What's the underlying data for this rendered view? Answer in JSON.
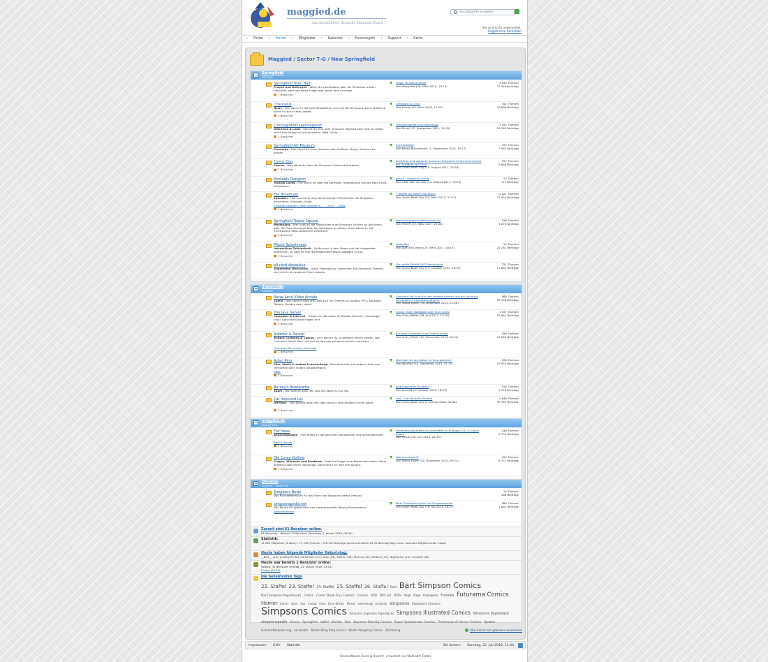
{
  "header": {
    "site_title": "maggied.de",
    "site_sub": "das dienstälteste deutsche Simpsons-Board",
    "search_placeholder": "Suchbegriffe eingeben",
    "login_status": "Sie sind nicht angemeldet.",
    "register": "Registrieren",
    "login": "Anmelden"
  },
  "nav": [
    "Portal",
    "Forum",
    "Mitglieder",
    "Kalender",
    "Forenregeln",
    "Support",
    "Karte"
  ],
  "breadcrumb": "Maggied / Sector 7-G / New Springfield",
  "categories": [
    {
      "title": "Springfield",
      "subtitle": "Off-Topic",
      "boards": [
        {
          "name": "Springfield Town Hall",
          "desc_b": "Fragen und Umfragen",
          "desc": " - Wenn du irgendetwas über die Simpsons wissen möchtest, stell hier deine Frage oder starte eine Umfrage.",
          "visitors": "7 Besucher",
          "lp_title": "Frage: Hinweisschilder",
          "lp_by": "Von stoppoker (26. März 2018, 18:13)",
          "threads": "4 184 Themen",
          "posts": "37 349 Beiträge"
        },
        {
          "name": "Channel 6",
          "desc_b": "News",
          "desc": " - Hier könnt ihr aktuelle Neuigkeiten rund um die Simpsons lesen. Natürlich könnt ihr auch neue posten.",
          "visitors": "2 Besucher",
          "lp_title": "Simpsons & LEGO",
          "lp_by": "Von Freaky (24. März 2018, 12:32)",
          "threads": "352 Themen",
          "posts": "10 860 Beiträge"
        },
        {
          "name": "Comosglobalhypermeganet",
          "desc_b": "Webnews & Links",
          "desc": " - Kennst du eine gute Simpsons Website oder hast du selber eine? Hier kannst du sie vorstellen. Web-Guide",
          "visitors": "1 Besucher",
          "lp_title": "Simpsonspedia hat Geburtstag",
          "lp_by": "Von Blund (23. September 2015, 11:03)",
          "threads": "1 105 Themen",
          "posts": "19 248 Beiträge"
        },
        {
          "name": "Springfield Art Museum",
          "desc_b": "Fanworks",
          "desc": " - Hier könnt ihr eure Fanworks wie Grafiken, Storys, Videos usw. posten.",
          "visitors": "",
          "lp_title": "Eure Grafiken",
          "lp_by": "Von Kenny Brockelstein (1. September 2015, 15:17)",
          "threads": "325 Themen",
          "posts": "7 067 Beiträge"
        },
        {
          "name": "Comic Con",
          "desc_b": "Comics",
          "desc": " - Hier könnt ihr über die Simpsons Comics diskutieren.",
          "visitors": "2 Besucher",
          "lp_title": "Limitierte und signierte deutsche Simpsons / Futurama Comics mit Zertifikat von Ohio",
          "lp_by": "Von Comic Book Guy (15. August 2017, 15:28)",
          "threads": "557 Themen",
          "posts": "6 688 Beiträge"
        },
        {
          "name": "Androids Dungeon",
          "desc_b": "Trading Cards",
          "desc": " - Hier könnt ihr über die normalen Tradingcards und die Bart-Cards diskutieren.",
          "visitors": "",
          "lp_title": "panini - simpsons mania",
          "lp_by": "Von Little Moe Szyslak (17. August 2017, 19:29)",
          "threads": "53 Themen",
          "posts": "717 Beiträge"
        },
        {
          "name": "Fox Broadcast",
          "desc_b": "Episoden",
          "desc": " - Hier kannst du über die einzelnen TV-Episoden der Simpsons diskutieren. Episoden-Guide",
          "subs": "Episodencapsules, Best Episode is..., ...2007, ...2009",
          "visitors": "1 Besucher",
          "lp_title": "7.Staffel Die bösen Nachbarn",
          "lp_by": "Von Comic Book Guy (24. März 2015, 22:37)",
          "threads": "1 227 Themen",
          "posts": "17 420 Beiträge"
        },
        {
          "name": "Springfield Towne Square",
          "desc_b": "Marktplatz",
          "desc": " - Hier habt ihr die Möglichkeit eure Simpsons-Sachen an den Mann oder die Frau zubringen bzw. Suchanfragen zu stellen. Auch könnt ihr auf interessante eBay-Auktionen verweisen.",
          "visitors": "2 Besucher",
          "lp_title": "Verkaufe original Weihnachts Cel",
          "lp_by": "Von PeterR (19. März 2017, 22:00)",
          "threads": "536 Themen",
          "posts": "4 078 Beiträge"
        },
        {
          "name": "Mount Splashmore",
          "desc_b": "Interaktiver Zeitvertreib",
          "desc": " - Sollte euch in dem Board mal die Langeweile bedrücken, so habt ihr hier die Möglichkeit etwas dagegen zu tun.",
          "visitors": "5 Besucher",
          "lp_title": "Sizee 90s",
          "lp_by": "Von Duff_and_more (24. März 2017, 18:43)",
          "threads": "55 Themen",
          "posts": "22 261 Beiträge"
        },
        {
          "name": "alt.nerd.obsessive",
          "desc_b": "Allgemeine Diskussion",
          "desc": " - Diese \"Newsgroup\" behandelt alle Simpsons-Themen, die nicht in die anderen Foren passen.",
          "visitors": "",
          "lp_title": "Der große Staffel DVD Pressthread",
          "lp_by": "Von Comic Book Guy (13. Oktober 2015, 18:25)",
          "threads": "751 Themen",
          "posts": "11 681 Beiträge"
        }
      ]
    },
    {
      "title": "Shelbyville",
      "subtitle": "Off-Topic",
      "boards": [
        {
          "name": "Noise Land Video Arcade",
          "desc_b": "Spiele",
          "desc": " - Hier kommt alles rein, was sich um Themen zu Spielen (PCs, Konsolen, Tablets, Handys usw.) dreht.",
          "visitors": "",
          "lp_title": "Simpsons Hit And Run den Vorteile Ändern und die Leute wo rumlaufen in Charaktere ändern",
          "lp_by": "Von Tobias Egner (18. Dezember 2014, 21:08)",
          "threads": "988 Themen",
          "posts": "16 390 Beiträge"
        },
        {
          "name": "The Java Server",
          "desc_b": "Computer & Internet",
          "desc": " - Fragen zur Windows, IE-Mozilla, Security, Homepage usw.? Dann stellt eure Fragen hier.",
          "visitors": "1 Besucher",
          "lp_title": "Spiron: mein Notebook oder eure Links!",
          "lp_by": "Von Chris_Pfeiler (28. Juni 2017, 15:10)",
          "threads": "1 057 Themen",
          "posts": "22 940 Beiträge"
        },
        {
          "name": "Arbeiter & Parasit",
          "desc_b": "Andere Cartoons & Comics",
          "desc": " - Hier kommt du zu anderen Serien posten, wie Futurama, South Park und halt all das was wir gerne gucken und lesen ...",
          "subs": "Futurama, Bruchbach Serenade",
          "visitors": "1 Besucher",
          "lp_title": "Ein paar Gedanken zum Thema Anime",
          "lp_by": "Von Chris_Pfeiler (11. November 2013, 10:15)",
          "threads": "598 Themen",
          "posts": "17 092 Beiträge"
        },
        {
          "name": "Aztec Kino",
          "desc_b": "Film, Musik & andere Unterhaltung",
          "desc": " - Diskutiert hier mit anderen über das Fernsehen oder andere Alltagsmedien.",
          "subs": "KBBL",
          "visitors": "1 Besucher",
          "lp_title": "Was habt ihr als letztes im Kino gesehen?",
          "lp_by": "Von WickPad (15. Dezember 2014, 12:13)",
          "threads": "726 Themen",
          "posts": "19 924 Beiträge"
        },
        {
          "name": "Barney's Bowlarama",
          "desc_b": "Sport",
          "desc": " - Hier kommt alles rein was mit Sport zu tun hat.",
          "visitors": "",
          "lp_title": "Lieblingsverein (Fußball)",
          "lp_by": "Von Anna09 (4. Oktober 2014, 16:55)",
          "threads": "256 Themen",
          "posts": "7 124 Beiträge"
        },
        {
          "name": "Car Impound Lot",
          "desc_b": "Off-Topic",
          "desc": " - Hier kommt alles rein, was sonst in kein anderes Forum passt.",
          "visitors": "3 Besucher",
          "lp_title": "Wall - Der Neujahrs-Thread",
          "lp_by": "Von Comic Book Guy (1. Januar 2016, 00:06)",
          "threads": "1 646 Themen",
          "posts": "55 393 Beiträge"
        }
      ]
    },
    {
      "title": "maggied.de",
      "subtitle": "Boardintern",
      "boards": [
        {
          "name": "Fox News",
          "desc_b": "Ankündigungen",
          "desc": " - Hier findet ihr die aktuellen Neuigkeiten und Ankündigungen.",
          "subs": "Ranch Relaxo",
          "visitors": "2 Besucher",
          "lp_title": "Vorbereitungsthread für Usertreffen in Erlangen 2014 (Comic Salon)",
          "lp_by": "Von Pascal (30. Juni 2014, 20:35)",
          "threads": "248 Themen",
          "posts": "6 755 Beiträge"
        },
        {
          "name": "Die Corey-Hotline",
          "desc_b": "Fragen, Wünsche und Feedback",
          "desc": " - Habt ihr Fragen zum Board oder einen Fehler entdeckt oder einen Vorschlag? Dann könnt ihr dies hier posten.",
          "visitors": "1 Besucher",
          "lp_title": "Was ist passiert?",
          "lp_by": "Von Tobias Egner (24. Dezember 2015, 09:31)",
          "threads": "453 Themen",
          "posts": "8 771 Beiträge"
        }
      ]
    },
    {
      "title": "Diorama",
      "subtitle": "Projekte - Sector 6G",
      "boards": [
        {
          "name": "Simpsons News",
          "desc_b": "",
          "desc": "Das Mitarbeiterforum für das Team von Simpsons News! (Pascal)",
          "visitors": "",
          "lp_title": "",
          "lp_by": "",
          "threads": "24 Themen",
          "posts": "408 Beiträge"
        },
        {
          "name": "simpsonspedia.net",
          "desc_b": "",
          "desc": "Das Forum für aktive User von simpsonspedia! (Kenny Brockelstein)",
          "subs": "Episodenfehler",
          "visitors": "",
          "lp_title": "Mehr Radioactive Man auf Simpsonspedia",
          "lp_by": "Von Comic Book Guy (19. Juli 2013, 16:37)",
          "threads": "280 Themen",
          "posts": "1 882 Beiträge"
        }
      ]
    }
  ],
  "stats": {
    "online_h": "Zurzeit sind 61 Benutzer online:",
    "online_d": "61 Besucher - Rekord: 12 Benutzer (Samstag, 3. Januar 2016, 09:34)",
    "stat_h": "Statistik:",
    "stat_d": "11 629 Mitglieder (6 aktiv) - 17 338 Themen - 318 207 Beiträge (durchschnittlich 49,39 Beiträge/Tag) Unser neuestes Mitglied heißt: Sawaj.",
    "bday_h": "Heute haben folgende Mitglieder Geburtstag:",
    "bday_d": "__Bart__ (24), guidolyrit (30), hartshirsch (27), Joey (31), Mjérrin (38), Marcus (32), McBane (27), Nightmare (25), uchse00 (29)",
    "was_h": "Heute war bereits 1 Benutzer online:",
    "was_d": "Rekord: 32 Benutzer (Freitag, 22. Januar 2016, 23:51)",
    "was_user": "Freaky (00:59)",
    "tags_h": "Die beliebtesten Tags"
  },
  "tags": [
    {
      "t": "22. Staffel",
      "s": 7
    },
    {
      "t": "23. Staffel",
      "s": 7
    },
    {
      "t": "24. Staffel",
      "s": 5
    },
    {
      "t": "25. Staffel",
      "s": 7
    },
    {
      "t": "26. Staffel",
      "s": 6.5
    },
    {
      "t": "Bart",
      "s": 4.5
    },
    {
      "t": "Bart Simpson Comics",
      "s": 11
    },
    {
      "t": "Bart Simpson Paperbacks",
      "s": 4.5
    },
    {
      "t": "Comix",
      "s": 4.5
    },
    {
      "t": "Comic Book Guy Comics",
      "s": 4.5
    },
    {
      "t": "Comics",
      "s": 4.5
    },
    {
      "t": "DVD",
      "s": 4
    },
    {
      "t": "DVD Set",
      "s": 4
    },
    {
      "t": "DVDs",
      "s": 4
    },
    {
      "t": "folge",
      "s": 4
    },
    {
      "t": "frage",
      "s": 4
    },
    {
      "t": "fratorgesik",
      "s": 4
    },
    {
      "t": "Funnies",
      "s": 5
    },
    {
      "t": "Futurama Comics",
      "s": 8.5
    },
    {
      "t": "Homer",
      "s": 7
    },
    {
      "t": "horror",
      "s": 4
    },
    {
      "t": "itchy",
      "s": 4
    },
    {
      "t": "lisa",
      "s": 4
    },
    {
      "t": "marge",
      "s": 4
    },
    {
      "t": "moe",
      "s": 4
    },
    {
      "t": "One-Shots",
      "s": 4.5
    },
    {
      "t": "Poster",
      "s": 4
    },
    {
      "t": "sammlung",
      "s": 4
    },
    {
      "t": "scratchy",
      "s": 4
    },
    {
      "t": "simpsons",
      "s": 6
    },
    {
      "t": "Simpsons Classics",
      "s": 4.5
    },
    {
      "t": "Simpsons Comics",
      "s": 14
    },
    {
      "t": "Simpsons Explosion Paperbacks",
      "s": 4
    },
    {
      "t": "Simpsons Illustrated Comics",
      "s": 7.5
    },
    {
      "t": "Simpsons Paperback",
      "s": 5
    },
    {
      "t": "simpsonspedia",
      "s": 5
    },
    {
      "t": "skinner",
      "s": 4
    },
    {
      "t": "Springfield",
      "s": 4
    },
    {
      "t": "staffel",
      "s": 4
    },
    {
      "t": "Starlets",
      "s": 4
    },
    {
      "t": "Stile",
      "s": 4
    },
    {
      "t": "Summer Shindig Comics",
      "s": 4.5
    },
    {
      "t": "Super Spectacular Comics",
      "s": 4.5
    },
    {
      "t": "Treehouse of Horror Comics",
      "s": 4.5
    },
    {
      "t": "Updates",
      "s": 4
    },
    {
      "t": "Usertreffenplanung",
      "s": 4.5
    },
    {
      "t": "verkaufen",
      "s": 4
    },
    {
      "t": "Winter Wing Ding Comics",
      "s": 4
    },
    {
      "t": "Winter Wingding Comics",
      "s": 4
    },
    {
      "t": "Zeichnung",
      "s": 4
    }
  ],
  "mark_all": "Alle Foren als gelesen markieren",
  "footer": {
    "impressum": "Impressum",
    "hilfe": "Hilfe",
    "statistik": "Statistik",
    "stil": "Stil ändern",
    "date": "Sonntag, 22. Juli 2018, 11:44"
  },
  "credit": "Forensoftware: Burning Board®, entwickelt von WoltLab® GmbH"
}
